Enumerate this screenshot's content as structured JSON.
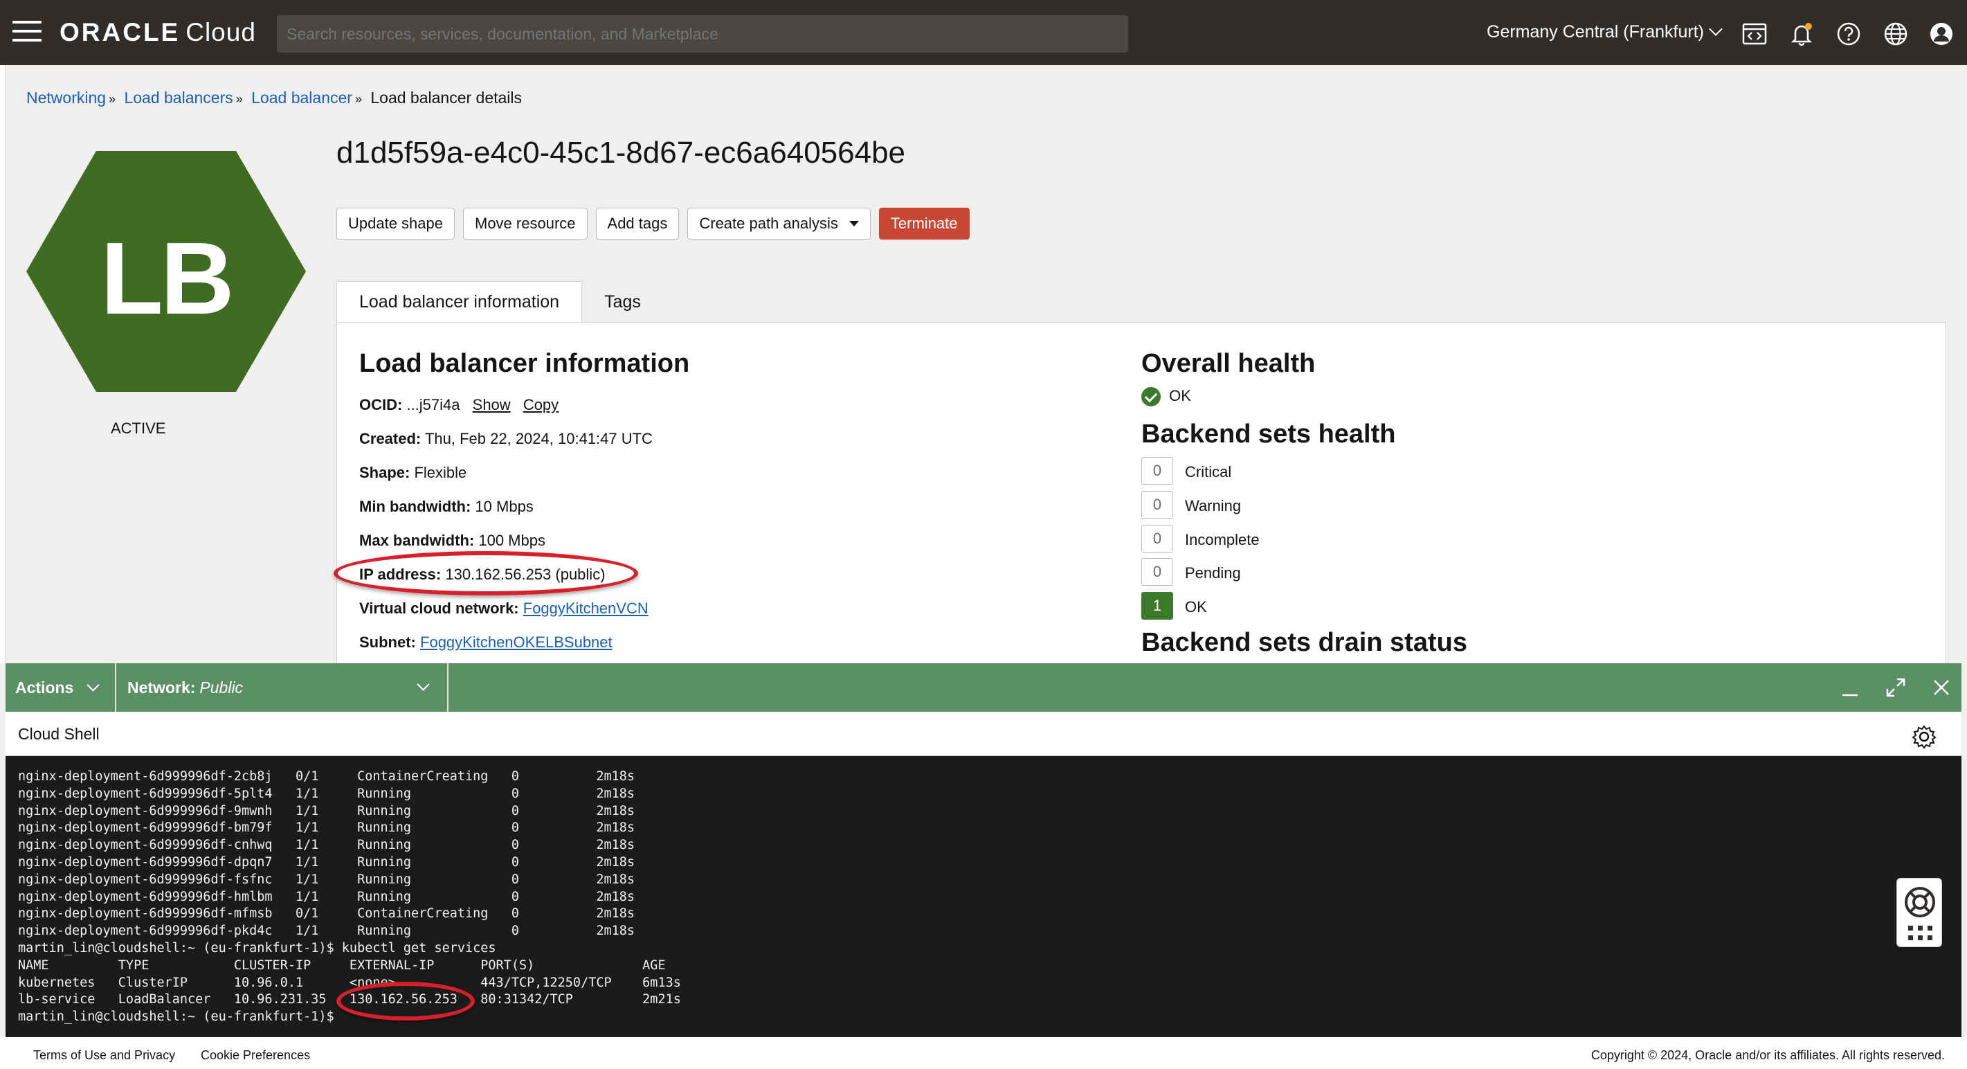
{
  "topbar": {
    "logo_brand": "ORACLE",
    "logo_product": "Cloud",
    "search_placeholder": "Search resources, services, documentation, and Marketplace",
    "region": "Germany Central (Frankfurt)",
    "icons": [
      "code-editor-icon",
      "bell-icon",
      "help-icon",
      "globe-icon",
      "user-icon"
    ]
  },
  "breadcrumb": {
    "items": [
      "Networking",
      "Load balancers",
      "Load balancer"
    ],
    "current": "Load balancer details"
  },
  "resource": {
    "badge": "LB",
    "badge_color": "#3f6b22",
    "state": "ACTIVE",
    "title": "d1d5f59a-e4c0-45c1-8d67-ec6a640564be"
  },
  "actions": {
    "update_shape": "Update shape",
    "move_resource": "Move resource",
    "add_tags": "Add tags",
    "create_path_analysis": "Create path analysis",
    "terminate": "Terminate"
  },
  "tabs": {
    "info": "Load balancer information",
    "tags": "Tags"
  },
  "info": {
    "heading": "Load balancer information",
    "ocid_label": "OCID:",
    "ocid_value": "...j57i4a",
    "show": "Show",
    "copy": "Copy",
    "created_label": "Created:",
    "created_value": "Thu, Feb 22, 2024, 10:41:47 UTC",
    "shape_label": "Shape:",
    "shape_value": "Flexible",
    "min_bw_label": "Min bandwidth:",
    "min_bw_value": "10 Mbps",
    "max_bw_label": "Max bandwidth:",
    "max_bw_value": "100 Mbps",
    "ip_label": "IP address:",
    "ip_value": "130.162.56.253 (public)",
    "vcn_label": "Virtual cloud network:",
    "vcn_value": "FoggyKitchenVCN",
    "subnet_label": "Subnet:",
    "subnet_value": "FoggyKitchenOKELBSubnet"
  },
  "health": {
    "overall_heading": "Overall health",
    "overall_status": "OK",
    "backend_heading": "Backend sets health",
    "rows": [
      {
        "count": "0",
        "label": "Critical"
      },
      {
        "count": "0",
        "label": "Warning"
      },
      {
        "count": "0",
        "label": "Incomplete"
      },
      {
        "count": "0",
        "label": "Pending"
      },
      {
        "count": "1",
        "label": "OK"
      }
    ],
    "drain_heading": "Backend sets drain status"
  },
  "shell": {
    "actions": "Actions",
    "network_label": "Network:",
    "network_value": "Public",
    "title": "Cloud Shell",
    "bar_color": "#5a9064",
    "lines": [
      "nginx-deployment-6d999996df-2cb8j   0/1     ContainerCreating   0          2m18s",
      "nginx-deployment-6d999996df-5plt4   1/1     Running             0          2m18s",
      "nginx-deployment-6d999996df-9mwnh   1/1     Running             0          2m18s",
      "nginx-deployment-6d999996df-bm79f   1/1     Running             0          2m18s",
      "nginx-deployment-6d999996df-cnhwq   1/1     Running             0          2m18s",
      "nginx-deployment-6d999996df-dpqn7   1/1     Running             0          2m18s",
      "nginx-deployment-6d999996df-fsfnc   1/1     Running             0          2m18s",
      "nginx-deployment-6d999996df-hmlbm   1/1     Running             0          2m18s",
      "nginx-deployment-6d999996df-mfmsb   0/1     ContainerCreating   0          2m18s",
      "nginx-deployment-6d999996df-pkd4c   1/1     Running             0          2m18s",
      "martin_lin@cloudshell:~ (eu-frankfurt-1)$ kubectl get services",
      "NAME         TYPE           CLUSTER-IP     EXTERNAL-IP      PORT(S)              AGE",
      "kubernetes   ClusterIP      10.96.0.1      <none>           443/TCP,12250/TCP    6m13s",
      "lb-service   LoadBalancer   10.96.231.35   130.162.56.253   80:31342/TCP         2m21s",
      "martin_lin@cloudshell:~ (eu-frankfurt-1)$ "
    ]
  },
  "footer": {
    "terms": "Terms of Use and Privacy",
    "cookies": "Cookie Preferences",
    "copyright": "Copyright © 2024, Oracle and/or its affiliates. All rights reserved."
  }
}
